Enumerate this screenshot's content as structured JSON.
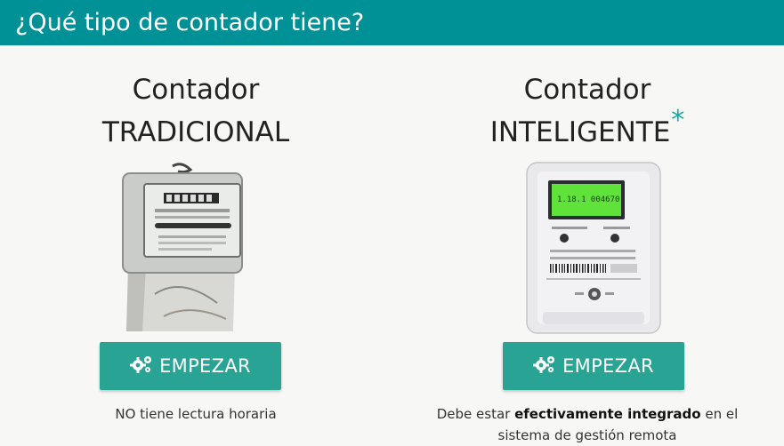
{
  "header": {
    "title": "¿Qué tipo de contador tiene?"
  },
  "options": [
    {
      "title_line1": "Contador",
      "title_line2": "TRADICIONAL",
      "button_label": "EMPEZAR",
      "button_icon": "gears-icon",
      "note": "NO tiene lectura horaria",
      "image": "traditional-meter"
    },
    {
      "title_line1": "Contador",
      "title_line2": "INTELIGENTE",
      "asterisk": "*",
      "button_label": "EMPEZAR",
      "button_icon": "gears-icon",
      "note_prefix": "Debe estar ",
      "note_bold": "efectivamente integrado",
      "note_suffix": " en el",
      "note_line2": "sistema de gestión remota",
      "display_text": "1.18.1  004670",
      "image": "smart-meter"
    }
  ],
  "colors": {
    "header_bg": "#009196",
    "button_bg": "#29a393",
    "asterisk": "#1aa89f",
    "page_bg": "#f7f7f5"
  }
}
